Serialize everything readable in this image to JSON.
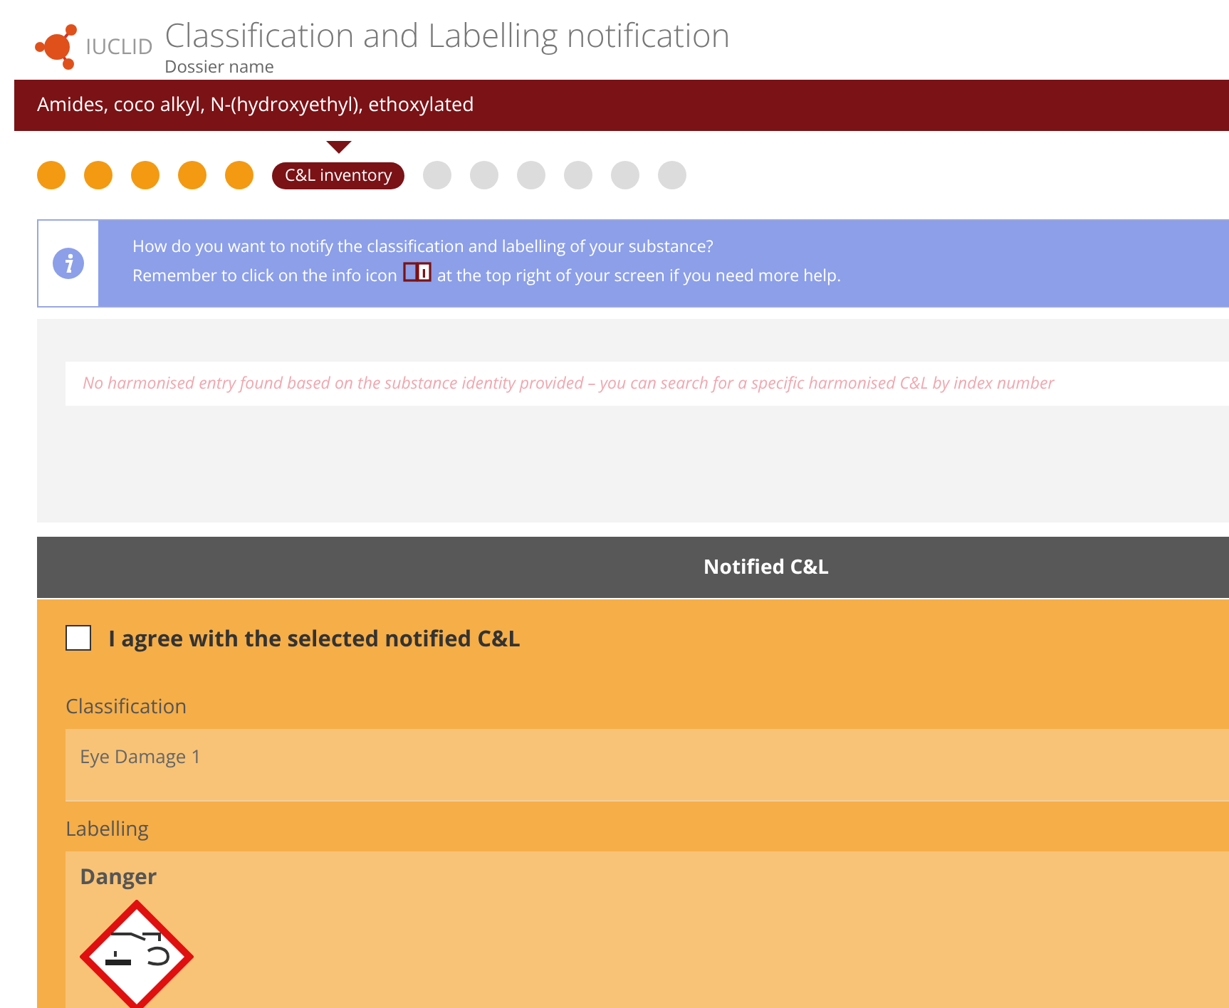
{
  "header": {
    "logo_text": "IUCLID",
    "title": "Classification and Labelling notification",
    "subtitle": "Dossier name"
  },
  "substance_bar": {
    "name": "Amides, coco alkyl, N-(hydroxyethyl), ethoxylated"
  },
  "steps": [
    {
      "kind": "done"
    },
    {
      "kind": "done"
    },
    {
      "kind": "done"
    },
    {
      "kind": "done"
    },
    {
      "kind": "done"
    },
    {
      "kind": "current",
      "label": "C&L inventory"
    },
    {
      "kind": "pending"
    },
    {
      "kind": "pending"
    },
    {
      "kind": "pending"
    },
    {
      "kind": "pending"
    },
    {
      "kind": "pending"
    },
    {
      "kind": "pending"
    }
  ],
  "info": {
    "line_1": "How do you want to notify the classification and labelling of your substance?",
    "line_2_before": "Remember to click on the info icon",
    "line_2_after": "at the top right of your screen if you need more help."
  },
  "harmonised": {
    "message": "No harmonised entry found based on the substance identity provided – you can search for a specific harmonised C&L by index number"
  },
  "notified": {
    "title": "Notified C&L",
    "agree": {
      "label": "I agree with the selected notified C&L",
      "checked": false
    },
    "classification_label": "Classification",
    "classification_value": "Eye Damage 1",
    "labelling_label": "Labelling",
    "signal_word": "Danger"
  }
}
